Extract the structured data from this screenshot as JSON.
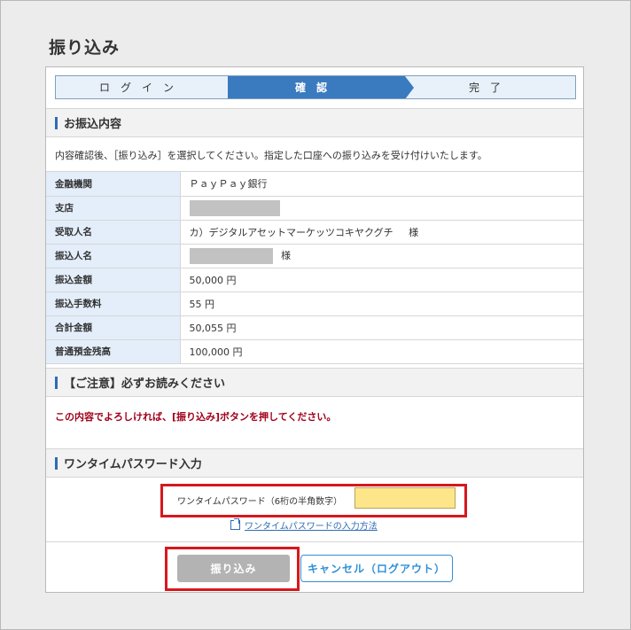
{
  "page": {
    "title": "振り込み"
  },
  "steps": [
    {
      "label": "ログイン",
      "active": false
    },
    {
      "label": "確認",
      "active": true
    },
    {
      "label": "完了",
      "active": false
    }
  ],
  "transfer": {
    "section_title": "お振込内容",
    "intro": "内容確認後、［振り込み］を選択してください。指定した口座への振り込みを受け付けいたします。",
    "rows": [
      {
        "label": "金融機関",
        "value": "ＰａｙＰａｙ銀行"
      },
      {
        "label": "支店",
        "value": ""
      },
      {
        "label": "受取人名",
        "value": "カ）デジタルアセットマーケッツコキヤクグチ",
        "suffix": "様"
      },
      {
        "label": "振込人名",
        "value": "",
        "suffix": "様"
      },
      {
        "label": "振込金額",
        "value": "50,000 円"
      },
      {
        "label": "振込手数料",
        "value": "55 円"
      },
      {
        "label": "合計金額",
        "value": "50,055 円"
      },
      {
        "label": "普通預金残高",
        "value": "100,000 円"
      }
    ]
  },
  "notice": {
    "section_title": "【ご注意】必ずお読みください",
    "text": "この内容でよろしければ、[振り込み]ボタンを押してください。"
  },
  "otp": {
    "section_title": "ワンタイムパスワード入力",
    "label": "ワンタイムパスワード（6桁の半角数字）",
    "value": "",
    "help_link": "ワンタイムパスワードの入力方法"
  },
  "actions": {
    "submit_label": "振り込み",
    "cancel_label": "キャンセル（ログアウト）"
  },
  "colors": {
    "accent": "#3a7abf",
    "highlight": "#d6181e",
    "notice": "#a0001a",
    "otp_field": "#fde68a"
  }
}
